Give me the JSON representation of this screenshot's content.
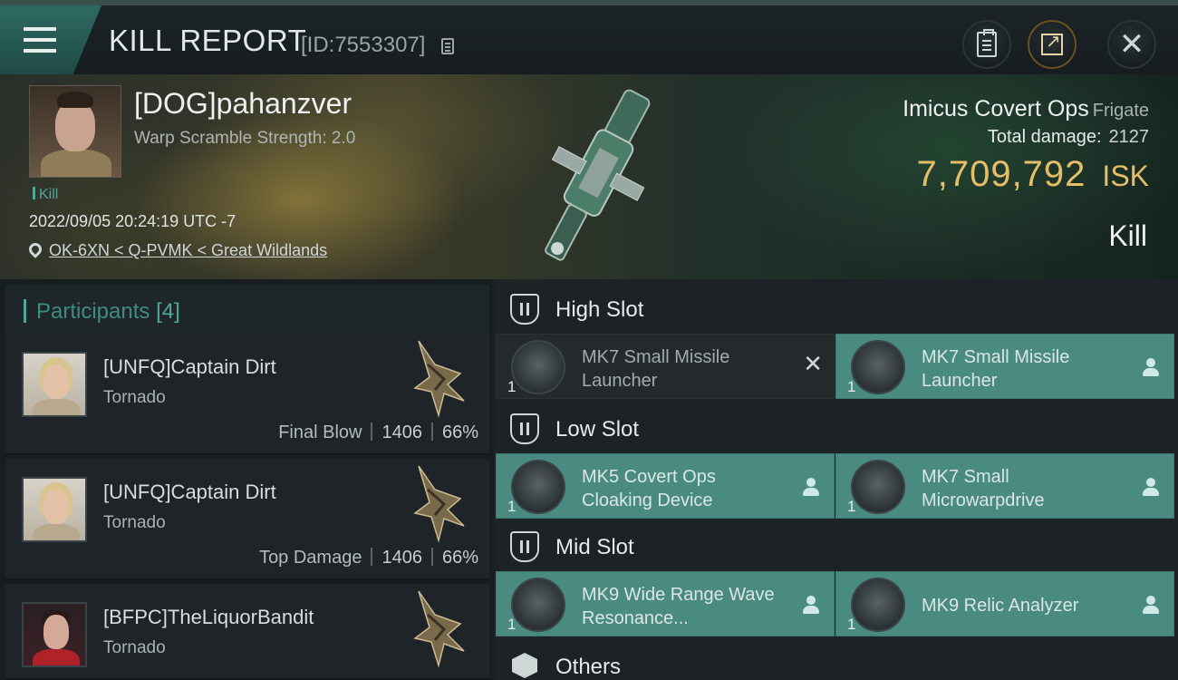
{
  "header": {
    "title": "KILL REPORT",
    "report_id": "[ID:7553307]",
    "icons": [
      "menu-icon",
      "copy-icon",
      "clipboard-icon",
      "share-icon",
      "close-icon"
    ]
  },
  "victim": {
    "name": "[DOG]pahanzver",
    "warp_scramble": "Warp Scramble Strength: 2.0",
    "kill_tag": "Kill",
    "datetime": "2022/09/05 20:24:19 UTC -7",
    "location": "OK-6XN < Q-PVMK < Great Wildlands",
    "ship_name": "Imicus Covert Ops",
    "ship_class": "Frigate",
    "total_damage_label": "Total damage:",
    "total_damage_value": "2127",
    "isk_value": "7,709,792",
    "isk_unit": "ISK",
    "result": "Kill"
  },
  "participants": {
    "title": "Participants",
    "count": "[4]",
    "rows": [
      {
        "name": "[UNFQ]Captain Dirt",
        "ship": "Tornado",
        "role": "Final Blow",
        "damage": "1406",
        "percent": "66%"
      },
      {
        "name": "[UNFQ]Captain Dirt",
        "ship": "Tornado",
        "role": "Top Damage",
        "damage": "1406",
        "percent": "66%"
      },
      {
        "name": "[BFPC]TheLiquorBandit",
        "ship": "Tornado",
        "role": "",
        "damage": "",
        "percent": ""
      }
    ]
  },
  "fitting": {
    "high_slot_label": "High Slot",
    "low_slot_label": "Low Slot",
    "mid_slot_label": "Mid Slot",
    "others_label": "Others",
    "high": [
      {
        "name": "MK7 Small Missile Launcher",
        "qty": "1",
        "status": "destroyed"
      },
      {
        "name": "MK7 Small Missile Launcher",
        "qty": "1",
        "status": "dropped"
      }
    ],
    "low": [
      {
        "name": "MK5 Covert Ops Cloaking Device",
        "qty": "1",
        "status": "dropped"
      },
      {
        "name": "MK7 Small Microwarpdrive",
        "qty": "1",
        "status": "dropped"
      }
    ],
    "mid": [
      {
        "name": "MK9 Wide Range Wave Resonance...",
        "qty": "1",
        "status": "dropped"
      },
      {
        "name": "MK9 Relic Analyzer",
        "qty": "1",
        "status": "dropped"
      }
    ]
  },
  "colors": {
    "accent_teal": "#4fa79b",
    "module_dropped": "#4a8b81",
    "module_destroyed": "#24292b",
    "isk_gold": "#e6bd68"
  }
}
